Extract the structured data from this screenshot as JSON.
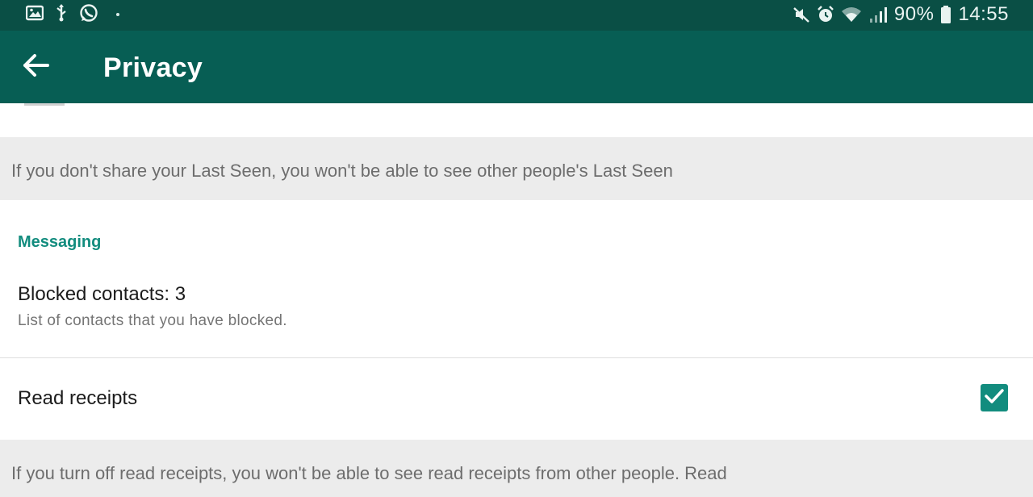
{
  "status_bar": {
    "left_icons": [
      "image-icon",
      "usb-icon",
      "whatsapp-icon",
      "dot-icon"
    ],
    "right_icons": [
      "mute-icon",
      "alarm-icon",
      "wifi-icon",
      "signal-icon"
    ],
    "battery": "90%",
    "time": "14:55"
  },
  "toolbar": {
    "back_icon": "back-arrow-icon",
    "title": "Privacy"
  },
  "last_seen_info": "If you don't share your Last Seen, you won't be able to see other people's Last Seen",
  "messaging": {
    "header": "Messaging",
    "blocked_contacts": {
      "title": "Blocked contacts: 3",
      "subtitle": "List of contacts that you have blocked."
    },
    "read_receipts": {
      "title": "Read receipts",
      "checked": true
    }
  },
  "read_receipts_info": "If you turn off read receipts, you won't be able to see read receipts from other people. Read",
  "colors": {
    "status_bar": "#0a4f45",
    "toolbar": "#075e54",
    "accent": "#128c7e",
    "info_background": "#ececec"
  }
}
